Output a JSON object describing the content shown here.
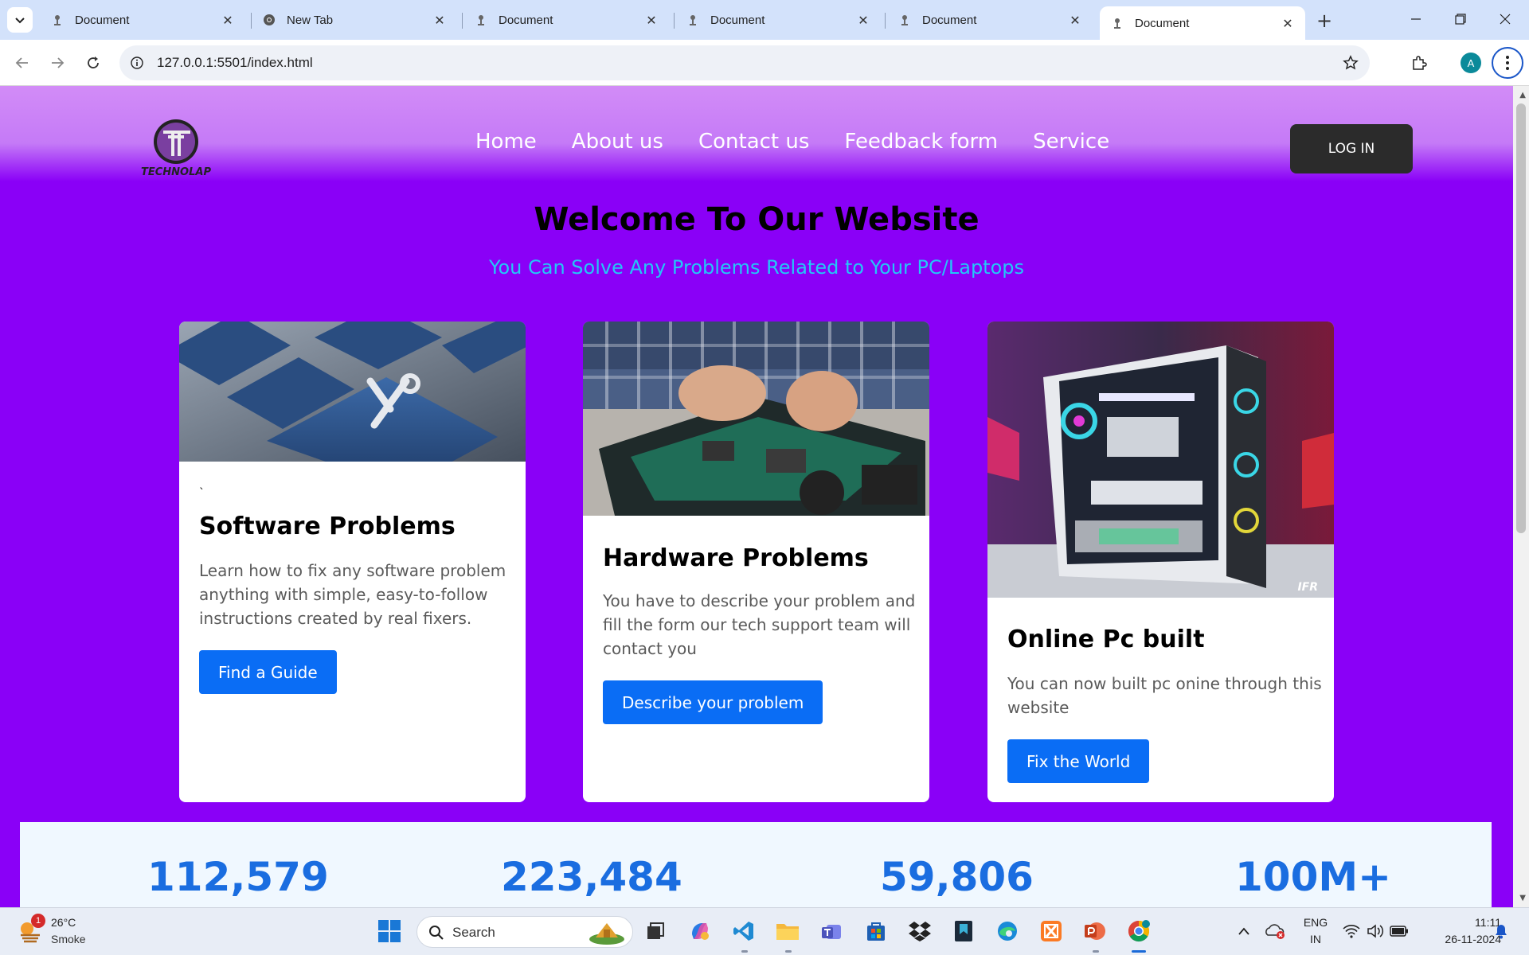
{
  "browser": {
    "tabs": [
      {
        "title": "Document",
        "active": false
      },
      {
        "title": "New Tab",
        "active": false
      },
      {
        "title": "Document",
        "active": false
      },
      {
        "title": "Document",
        "active": false
      },
      {
        "title": "Document",
        "active": false
      },
      {
        "title": "Document",
        "active": true
      }
    ],
    "url": "127.0.0.1:5501/index.html",
    "profile_initial": "A"
  },
  "site": {
    "logo_text": "TECHNOLAP",
    "nav": [
      "Home",
      "About us",
      "Contact us",
      "Feedback form",
      "Service"
    ],
    "login_label": "LOG IN",
    "hero_title": "Welcome To Our Website",
    "hero_subtitle": "You Can Solve Any Problems Related to Your PC/Laptops",
    "cards": [
      {
        "tick": "`",
        "title": "Software Problems",
        "text": "Learn how to fix any software problem anything with simple, easy-to-follow instructions created by real fixers.",
        "button": "Find a Guide"
      },
      {
        "title": "Hardware Problems",
        "text": "You have to describe your problem and fill the form our tech support team will contact you",
        "button": "Describe your problem"
      },
      {
        "title": "Online Pc built",
        "text": "You can now built pc onine through this website",
        "button": "Fix the World",
        "image_watermark": "IFR"
      }
    ],
    "stats": [
      "112,579",
      "223,484",
      "59,806",
      "100M+"
    ]
  },
  "taskbar": {
    "weather_temp": "26°C",
    "weather_condition": "Smoke",
    "weather_badge": "1",
    "search_label": "Search",
    "lang_top": "ENG",
    "lang_bottom": "IN",
    "time": "11:11",
    "date": "26-11-2024",
    "pinned_icons": [
      "start-icon",
      "search-icon",
      "task-view-icon",
      "copilot-icon",
      "vscode-icon",
      "file-explorer-icon",
      "teams-icon",
      "microsoft-store-icon",
      "dropbox-icon",
      "bookmark-app-icon",
      "edge-icon",
      "xampp-icon",
      "powerpoint-icon",
      "chrome-icon"
    ]
  },
  "colors": {
    "page_bg": "#8a00f7",
    "accent_button": "#0a6df5",
    "subtitle": "#23c8f7",
    "stat_number": "#1a6de0"
  }
}
